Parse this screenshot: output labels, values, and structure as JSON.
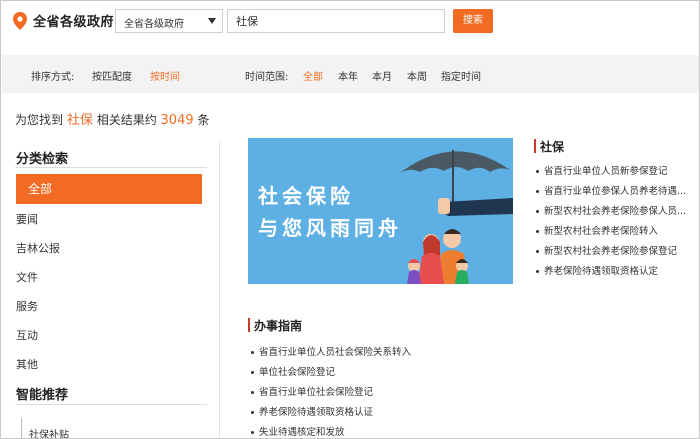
{
  "header": {
    "site_title": "全省各级政府",
    "scope_select_value": "全省各级政府",
    "search_value": "社保",
    "search_button": "搜索"
  },
  "filter_bar": {
    "sort_label": "排序方式:",
    "sort_options": [
      "按匹配度",
      "按时间"
    ],
    "sort_active": "按时间",
    "time_label": "时间范围:",
    "time_options": [
      "全部",
      "本年",
      "本月",
      "本周",
      "指定时间"
    ],
    "time_active": "全部"
  },
  "result": {
    "prefix": "为您找到",
    "keyword": "社保",
    "middle": "相关结果约",
    "count": "3049",
    "suffix": "条"
  },
  "sidebar": {
    "category_title": "分类检索",
    "active_item": "全部",
    "items": [
      "要闻",
      "吉林公报",
      "文件",
      "服务",
      "互动",
      "其他"
    ],
    "recommend_title": "智能推荐",
    "recommend_items": [
      "社保补贴"
    ]
  },
  "banner": {
    "line1": "社会保险",
    "line2": "与您风雨同舟",
    "background": "#5eb0e4"
  },
  "shebao": {
    "title": "社保",
    "items": [
      "省直行业单位人员新参保登记",
      "省直行业单位参保人员养老待遇...",
      "新型农村社会养老保险参保人员...",
      "新型农村社会养老保险转入",
      "新型农村社会养老保险参保登记",
      "养老保险待遇领取资格认定"
    ]
  },
  "guide": {
    "title": "办事指南",
    "items": [
      "省直行业单位人员社会保险关系转入",
      "单位社会保险登记",
      "省直行业单位社会保险登记",
      "养老保险待遇领取资格认证",
      "失业待遇核定和发放"
    ]
  },
  "colors": {
    "accent": "#f26b22",
    "section_bar": "#c83a2a",
    "banner_blue": "#5eb0e4"
  }
}
